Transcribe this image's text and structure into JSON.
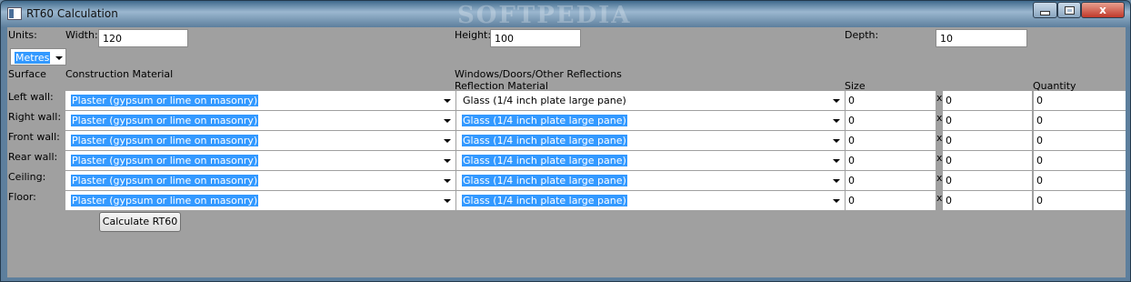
{
  "window": {
    "title": "RT60 Calculation",
    "watermark": "SOFTPEDIA",
    "controls": {
      "minimize": "minimize",
      "maximize": "maximize",
      "close": "x"
    }
  },
  "dimensions": {
    "units_label": "Units:",
    "units_value": "Metres",
    "width_label": "Width:",
    "width_value": "120",
    "height_label": "Height:",
    "height_value": "100",
    "depth_label": "Depth:",
    "depth_value": "10"
  },
  "headers": {
    "surface": "Surface",
    "construction": "Construction Material",
    "windows": "Windows/Doors/Other Reflections",
    "reflection": "Reflection Material",
    "size": "Size",
    "quantity": "Quantity",
    "x_symbol": "x"
  },
  "rows": [
    {
      "surface": "Left wall:",
      "construction": "Plaster (gypsum or lime on masonry)",
      "reflection": "Glass (1/4 inch plate large pane)",
      "size_a": "0",
      "size_b": "0",
      "quantity": "0"
    },
    {
      "surface": "Right wall:",
      "construction": "Plaster (gypsum or lime on masonry)",
      "reflection": "Glass (1/4 inch plate large pane)",
      "size_a": "0",
      "size_b": "0",
      "quantity": "0"
    },
    {
      "surface": "Front wall:",
      "construction": "Plaster (gypsum or lime on masonry)",
      "reflection": "Glass (1/4 inch plate large pane)",
      "size_a": "0",
      "size_b": "0",
      "quantity": "0"
    },
    {
      "surface": "Rear wall:",
      "construction": "Plaster (gypsum or lime on masonry)",
      "reflection": "Glass (1/4 inch plate large pane)",
      "size_a": "0",
      "size_b": "0",
      "quantity": "0"
    },
    {
      "surface": "Ceiling:",
      "construction": "Plaster (gypsum or lime on masonry)",
      "reflection": "Glass (1/4 inch plate large pane)",
      "size_a": "0",
      "size_b": "0",
      "quantity": "0"
    },
    {
      "surface": "Floor:",
      "construction": "Plaster (gypsum or lime on masonry)",
      "reflection": "Glass (1/4 inch plate large pane)",
      "size_a": "0",
      "size_b": "0",
      "quantity": "0"
    }
  ],
  "calculate_label": "Calculate RT60",
  "colors": {
    "selection": "#3399ff",
    "client_bg": "#a0a0a0"
  }
}
